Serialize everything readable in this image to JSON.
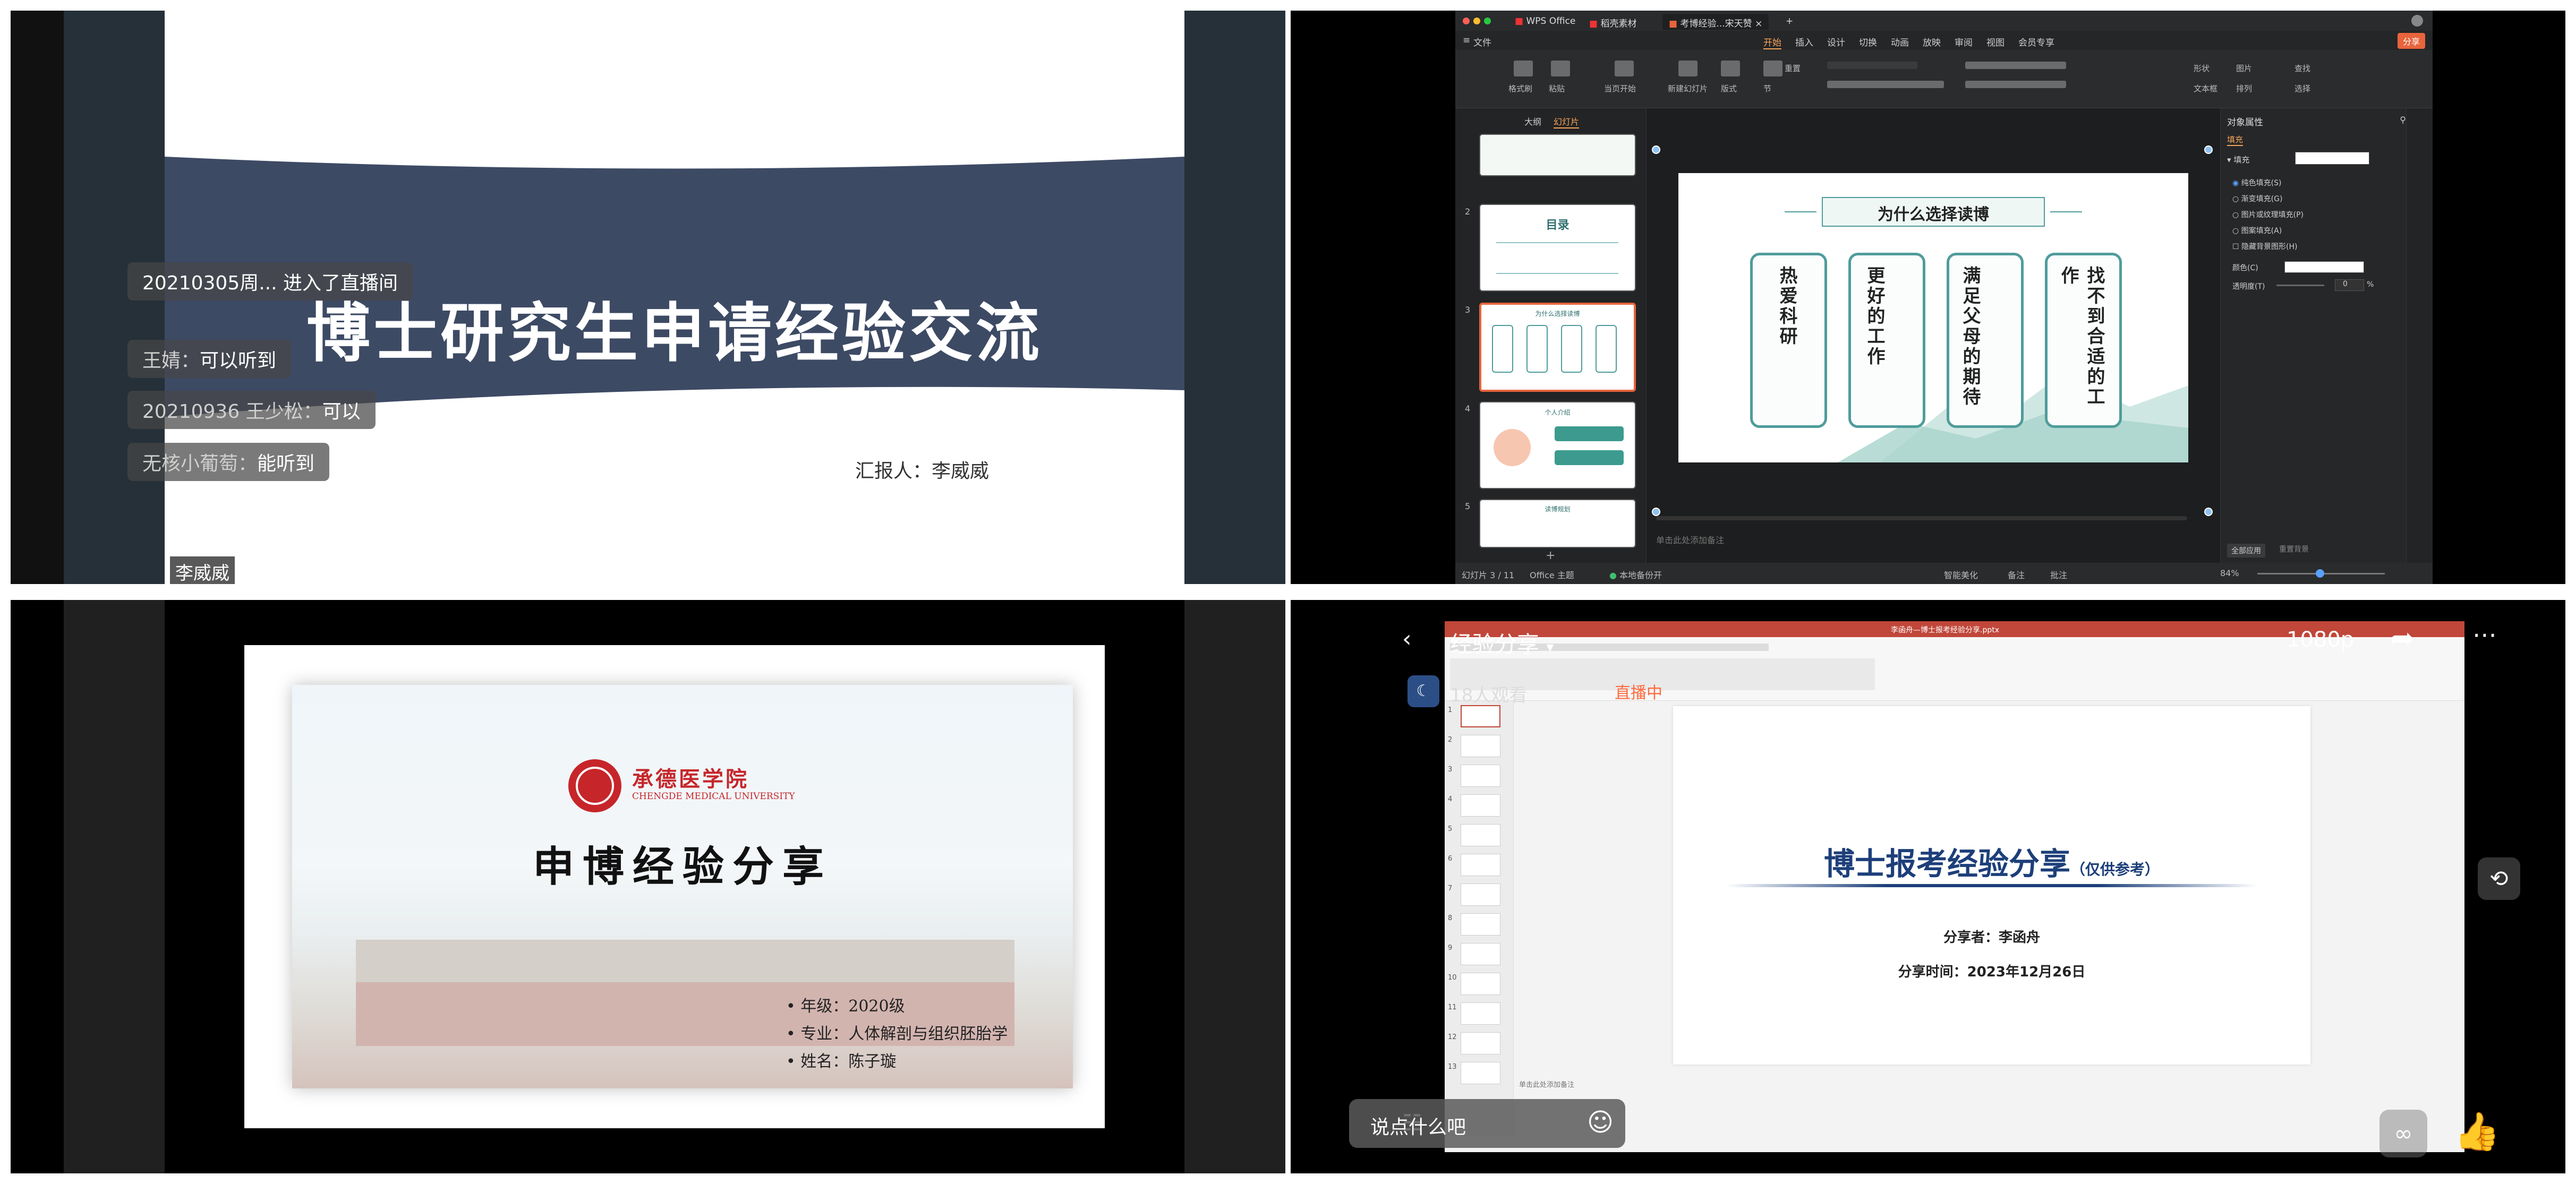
{
  "q1": {
    "title": "博士研究生申请经验交流",
    "reporter": "汇报人：李威威",
    "chat": [
      {
        "who": "",
        "text": "20210305周... 进入了直播间"
      },
      {
        "who": "王婧：",
        "text": "可以听到"
      },
      {
        "who": "20210936 王少松：",
        "text": "可以"
      },
      {
        "who": "无核小葡萄：",
        "text": "能听到"
      }
    ],
    "presenter": "李威威",
    "colors": {
      "band": "#3d4a64",
      "side": "#253038"
    }
  },
  "q2": {
    "tabs": [
      "WPS Office",
      "稻壳素材",
      "考博经验...宋天赞"
    ],
    "menu": [
      "文件",
      "开始",
      "插入",
      "设计",
      "切换",
      "动画",
      "放映",
      "审阅",
      "视图",
      "会员专享"
    ],
    "share": "分享",
    "ribbon_labels": [
      "格式刷",
      "粘贴",
      "当页开始",
      "新建幻灯片",
      "版式",
      "节",
      "重置",
      "形状",
      "图片",
      "查找",
      "文本框",
      "排列",
      "选择"
    ],
    "panel_tabs": [
      "大纲",
      "幻灯片"
    ],
    "thumb_numbers": [
      "2",
      "3",
      "4",
      "5"
    ],
    "thumb_titles": [
      "目录",
      "为什么选择读博",
      "个人介绍",
      "读博规划"
    ],
    "slide": {
      "heading": "为什么选择读博",
      "cards": [
        "热爱科研",
        "更好的工作",
        "满足父母的期待",
        "找不到合适的工作"
      ]
    },
    "notes_hint": "单击此处添加备注",
    "props": {
      "title": "对象属性",
      "tab": "填充",
      "section": "填充",
      "options": [
        "纯色填充(S)",
        "渐变填充(G)",
        "图片或纹理填充(P)",
        "图案填充(A)",
        "隐藏背景图形(H)"
      ],
      "color_label": "颜色(C)",
      "transparency_label": "透明度(T)",
      "transparency_value": "0",
      "transparency_unit": "%",
      "apply_all": "全部应用",
      "reset_bg": "重置背景"
    },
    "status": {
      "slide_pos": "幻灯片 3 / 11",
      "theme": "Office 主题",
      "backup": "本地备份开",
      "smart": "智能美化",
      "notes": "备注",
      "comments": "批注",
      "zoom": "84%"
    }
  },
  "q3": {
    "college": "承德医学院",
    "college_en": "CHENGDE MEDICAL UNIVERSITY",
    "title": "申博经验分享",
    "bullets": [
      "年级：2020级",
      "专业：人体解剖与组织胚胎学",
      "姓名：陈子璇"
    ]
  },
  "q4": {
    "room_title": "经验分享",
    "quality": "1080p",
    "viewers": "18人观看",
    "live_badge": "直播中",
    "slide_title": "博士报考经验分享",
    "slide_subtitle": "（仅供参考）",
    "presenter": "分享者：李函舟",
    "date": "分享时间：2023年12月26日",
    "file_name": "李函舟—博士报考经验分享.pptx",
    "thumb_numbers": [
      "1",
      "2",
      "3",
      "4",
      "5",
      "6",
      "7",
      "8",
      "9",
      "10",
      "11",
      "12",
      "13"
    ],
    "notes_hint": "单击此处添加备注",
    "input_placeholder": "说点什么吧",
    "colors": {
      "title": "#1d3f7a",
      "topbar": "#c0473a"
    }
  }
}
